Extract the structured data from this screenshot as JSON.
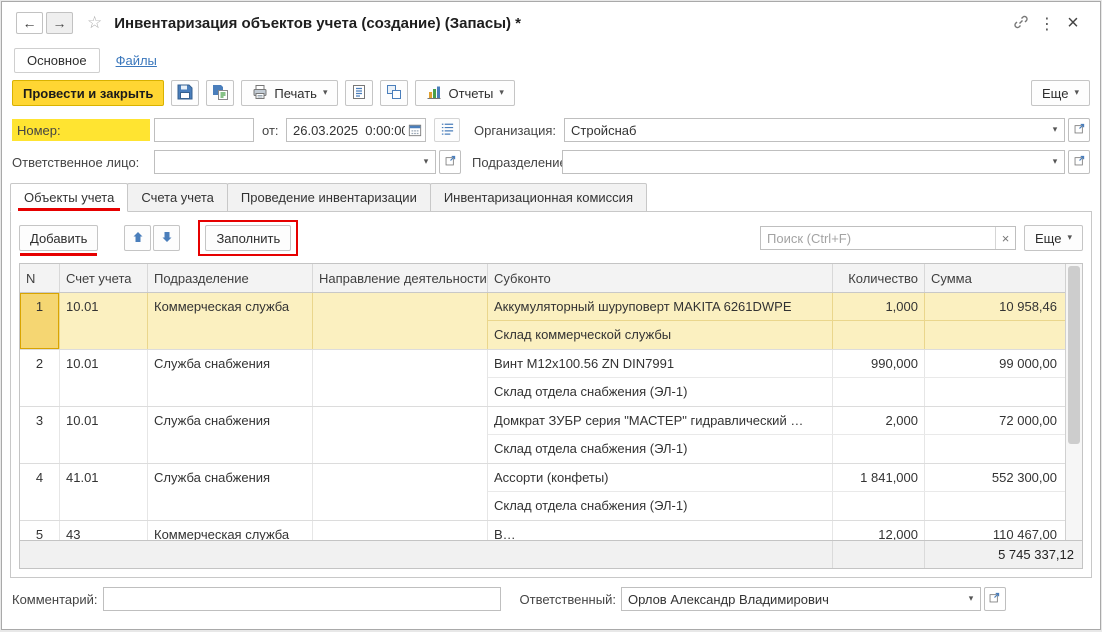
{
  "window": {
    "title": "Инвентаризация объектов учета (создание) (Запасы) *",
    "nav": {
      "main": "Основное",
      "files": "Файлы"
    }
  },
  "glyphs": {
    "back": "←",
    "forward": "→",
    "star": "☆",
    "kebab": "⋮",
    "close": "×",
    "caret": "▾",
    "clear": "×"
  },
  "colors": {
    "accent_yellow": "#FFD633",
    "annotation_red": "#E60000",
    "selection_yellow": "#FBF0C0",
    "link_blue": "#3A77BC",
    "label_highlight_yellow": "#FFE431"
  },
  "toolbar": {
    "post_close": "Провести и закрыть",
    "print": "Печать",
    "reports": "Отчеты",
    "more": "Еще"
  },
  "header_fields": {
    "number_label": "Номер:",
    "number_value": "",
    "date_label": "от:",
    "date_value": "26.03.2025  0:00:00",
    "org_label": "Организация:",
    "org_value": "Стройснаб",
    "responsible_person_label": "Ответственное лицо:",
    "responsible_person_value": "",
    "department_label": "Подразделение:",
    "department_value": ""
  },
  "tabs": [
    {
      "label": "Объекты учета",
      "active": true
    },
    {
      "label": "Счета учета",
      "active": false
    },
    {
      "label": "Проведение инвентаризации",
      "active": false
    },
    {
      "label": "Инвентаризационная комиссия",
      "active": false
    }
  ],
  "table_toolbar": {
    "add": "Добавить",
    "fill": "Заполнить",
    "search_placeholder": "Поиск (Ctrl+F)",
    "more": "Еще"
  },
  "table": {
    "columns": [
      "N",
      "Счет учета",
      "Подразделение",
      "Направление деятельности",
      "Субконто",
      "Количество",
      "Сумма"
    ],
    "rows": [
      {
        "n": "1",
        "account": "10.01",
        "department": "Коммерческая служба",
        "activity": "",
        "item": "Аккумуляторный шуруповерт MAKITA 6261DWPE",
        "warehouse": "Склад коммерческой службы",
        "qty": "1,000",
        "sum": "10 958,46",
        "selected": true
      },
      {
        "n": "2",
        "account": "10.01",
        "department": "Служба снабжения",
        "activity": "",
        "item": "Винт М12х100.56 ZN DIN7991",
        "warehouse": "Склад отдела снабжения (ЭЛ-1)",
        "qty": "990,000",
        "sum": "99 000,00",
        "selected": false
      },
      {
        "n": "3",
        "account": "10.01",
        "department": "Служба снабжения",
        "activity": "",
        "item": "Домкрат ЗУБР серия \"МАСТЕР\" гидравлический …",
        "warehouse": "Склад отдела снабжения (ЭЛ-1)",
        "qty": "2,000",
        "sum": "72 000,00",
        "selected": false
      },
      {
        "n": "4",
        "account": "41.01",
        "department": "Служба снабжения",
        "activity": "",
        "item": "Ассорти (конфеты)",
        "warehouse": "Склад отдела снабжения (ЭЛ-1)",
        "qty": "1 841,000",
        "sum": "552 300,00",
        "selected": false
      },
      {
        "n": "5",
        "account": "43",
        "department": "Коммерческая служба",
        "activity": "",
        "item": "В…",
        "warehouse": "",
        "qty": "12,000",
        "sum": "110 467,00",
        "selected": false
      }
    ],
    "total_sum": "5 745 337,12"
  },
  "footer": {
    "comment_label": "Комментарий:",
    "comment_value": "",
    "responsible_label": "Ответственный:",
    "responsible_value": "Орлов Александр Владимирович"
  }
}
